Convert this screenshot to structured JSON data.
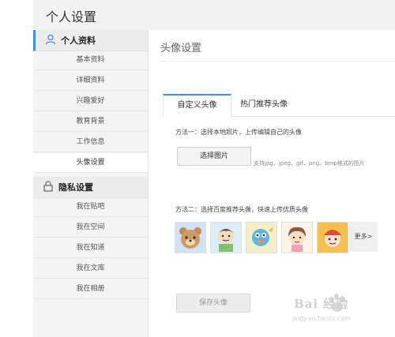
{
  "header": {
    "title": "个人设置"
  },
  "sidebar": {
    "section1": {
      "label": "个人资料",
      "icon": "user-icon"
    },
    "section1_items": [
      "基本资料",
      "详细资料",
      "兴趣爱好",
      "教育背景",
      "工作信息",
      "头像设置"
    ],
    "selected": "头像设置",
    "section2": {
      "label": "隐私设置",
      "icon": "lock-icon"
    },
    "section2_items": [
      "我在贴吧",
      "我在空间",
      "我在知道",
      "我在文库",
      "我在相册"
    ]
  },
  "main": {
    "title": "头像设置",
    "tabs": [
      "自定义头像",
      "热门推荐头像"
    ],
    "method1": "方法一：选择本地照片，上传编辑自己的头像",
    "choose_button": "选择图片",
    "support_text": "支持jpg、jpeg、gif、png、bmp格式的图片",
    "method2": "方法二：选择百度推荐头像，快速上传优质头像",
    "avatars": [
      "bear-avatar",
      "boy-avatar",
      "blue-creature-avatar",
      "girl-avatar",
      "red-hat-avatar"
    ],
    "more_button": "更多>",
    "save_button": "保存头像"
  },
  "watermark": {
    "text": "Bai 经验",
    "url": "jingyan.baidu.com"
  },
  "colors": {
    "accent": "#3f8ee8",
    "sidebar_bg": "#f4f4f4"
  }
}
